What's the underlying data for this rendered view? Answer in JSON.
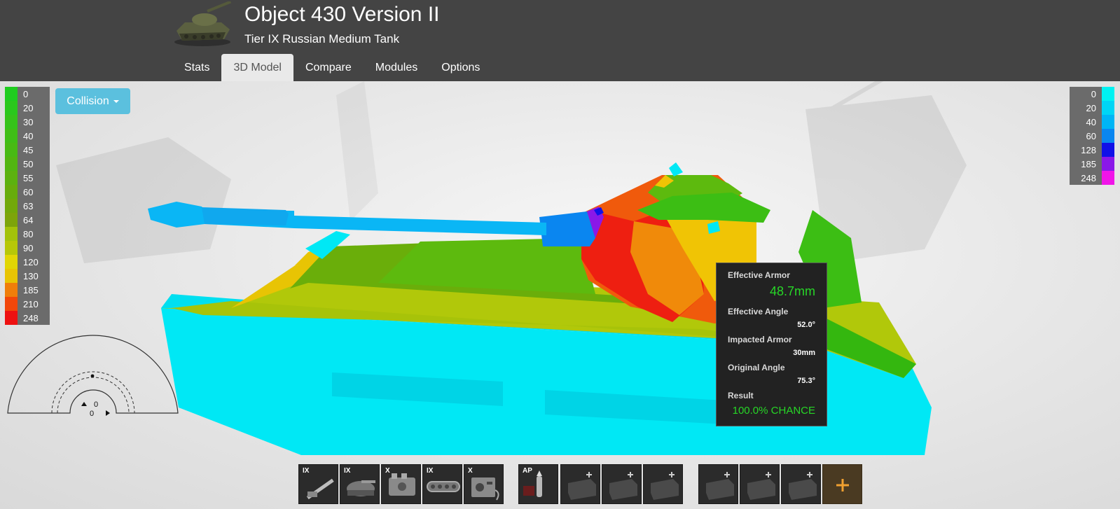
{
  "header": {
    "title": "Object 430 Version II",
    "subtitle": "Tier IX Russian Medium Tank",
    "tabs": [
      {
        "label": "Stats",
        "active": false
      },
      {
        "label": "3D Model",
        "active": true
      },
      {
        "label": "Compare",
        "active": false
      },
      {
        "label": "Modules",
        "active": false
      },
      {
        "label": "Options",
        "active": false
      }
    ]
  },
  "collision_button": {
    "label": "Collision"
  },
  "armor_legend": {
    "values": [
      "0",
      "20",
      "30",
      "40",
      "45",
      "50",
      "55",
      "60",
      "63",
      "64",
      "80",
      "90",
      "120",
      "130",
      "185",
      "210",
      "248"
    ],
    "colors": [
      "#1fcc1f",
      "#2ac81c",
      "#35c31a",
      "#3fbe17",
      "#48ba14",
      "#52b511",
      "#5cb10f",
      "#67ac0c",
      "#72a80a",
      "#7da40a",
      "#a3c20a",
      "#b7c708",
      "#e1d605",
      "#e8c404",
      "#f07e0a",
      "#f2470a",
      "#ee1111"
    ]
  },
  "spaced_legend": {
    "values": [
      "0",
      "20",
      "40",
      "60",
      "128",
      "185",
      "248"
    ],
    "colors": [
      "#00f2f2",
      "#00d5f5",
      "#00b5f5",
      "#0a86f0",
      "#1010e8",
      "#8a18e8",
      "#f015e8"
    ]
  },
  "tooltip": {
    "effective_armor_label": "Effective Armor",
    "effective_armor_value": "48.7mm",
    "effective_angle_label": "Effective Angle",
    "effective_angle_value": "52.0°",
    "impacted_armor_label": "Impacted Armor",
    "impacted_armor_value": "30mm",
    "original_angle_label": "Original Angle",
    "original_angle_value": "75.3°",
    "result_label": "Result",
    "result_value": "100.0% CHANCE"
  },
  "angle_widget": {
    "elevation": "0",
    "rotation": "0"
  },
  "equipment_slots": [
    {
      "tier": "IX",
      "icon": "gun-icon"
    },
    {
      "tier": "IX",
      "icon": "turret-icon"
    },
    {
      "tier": "X",
      "icon": "engine-icon"
    },
    {
      "tier": "IX",
      "icon": "tracks-icon"
    },
    {
      "tier": "X",
      "icon": "radio-icon"
    },
    {
      "tier": "AP",
      "icon": "ap-shell-icon"
    },
    {
      "tier": "",
      "icon": "consumable-slot-icon"
    },
    {
      "tier": "",
      "icon": "consumable-slot-icon"
    },
    {
      "tier": "",
      "icon": "consumable-slot-icon"
    },
    {
      "tier": "",
      "icon": "equipment-slot-icon"
    },
    {
      "tier": "",
      "icon": "equipment-slot-icon"
    },
    {
      "tier": "",
      "icon": "equipment-slot-icon"
    },
    {
      "tier": "+",
      "icon": "add-icon"
    }
  ]
}
